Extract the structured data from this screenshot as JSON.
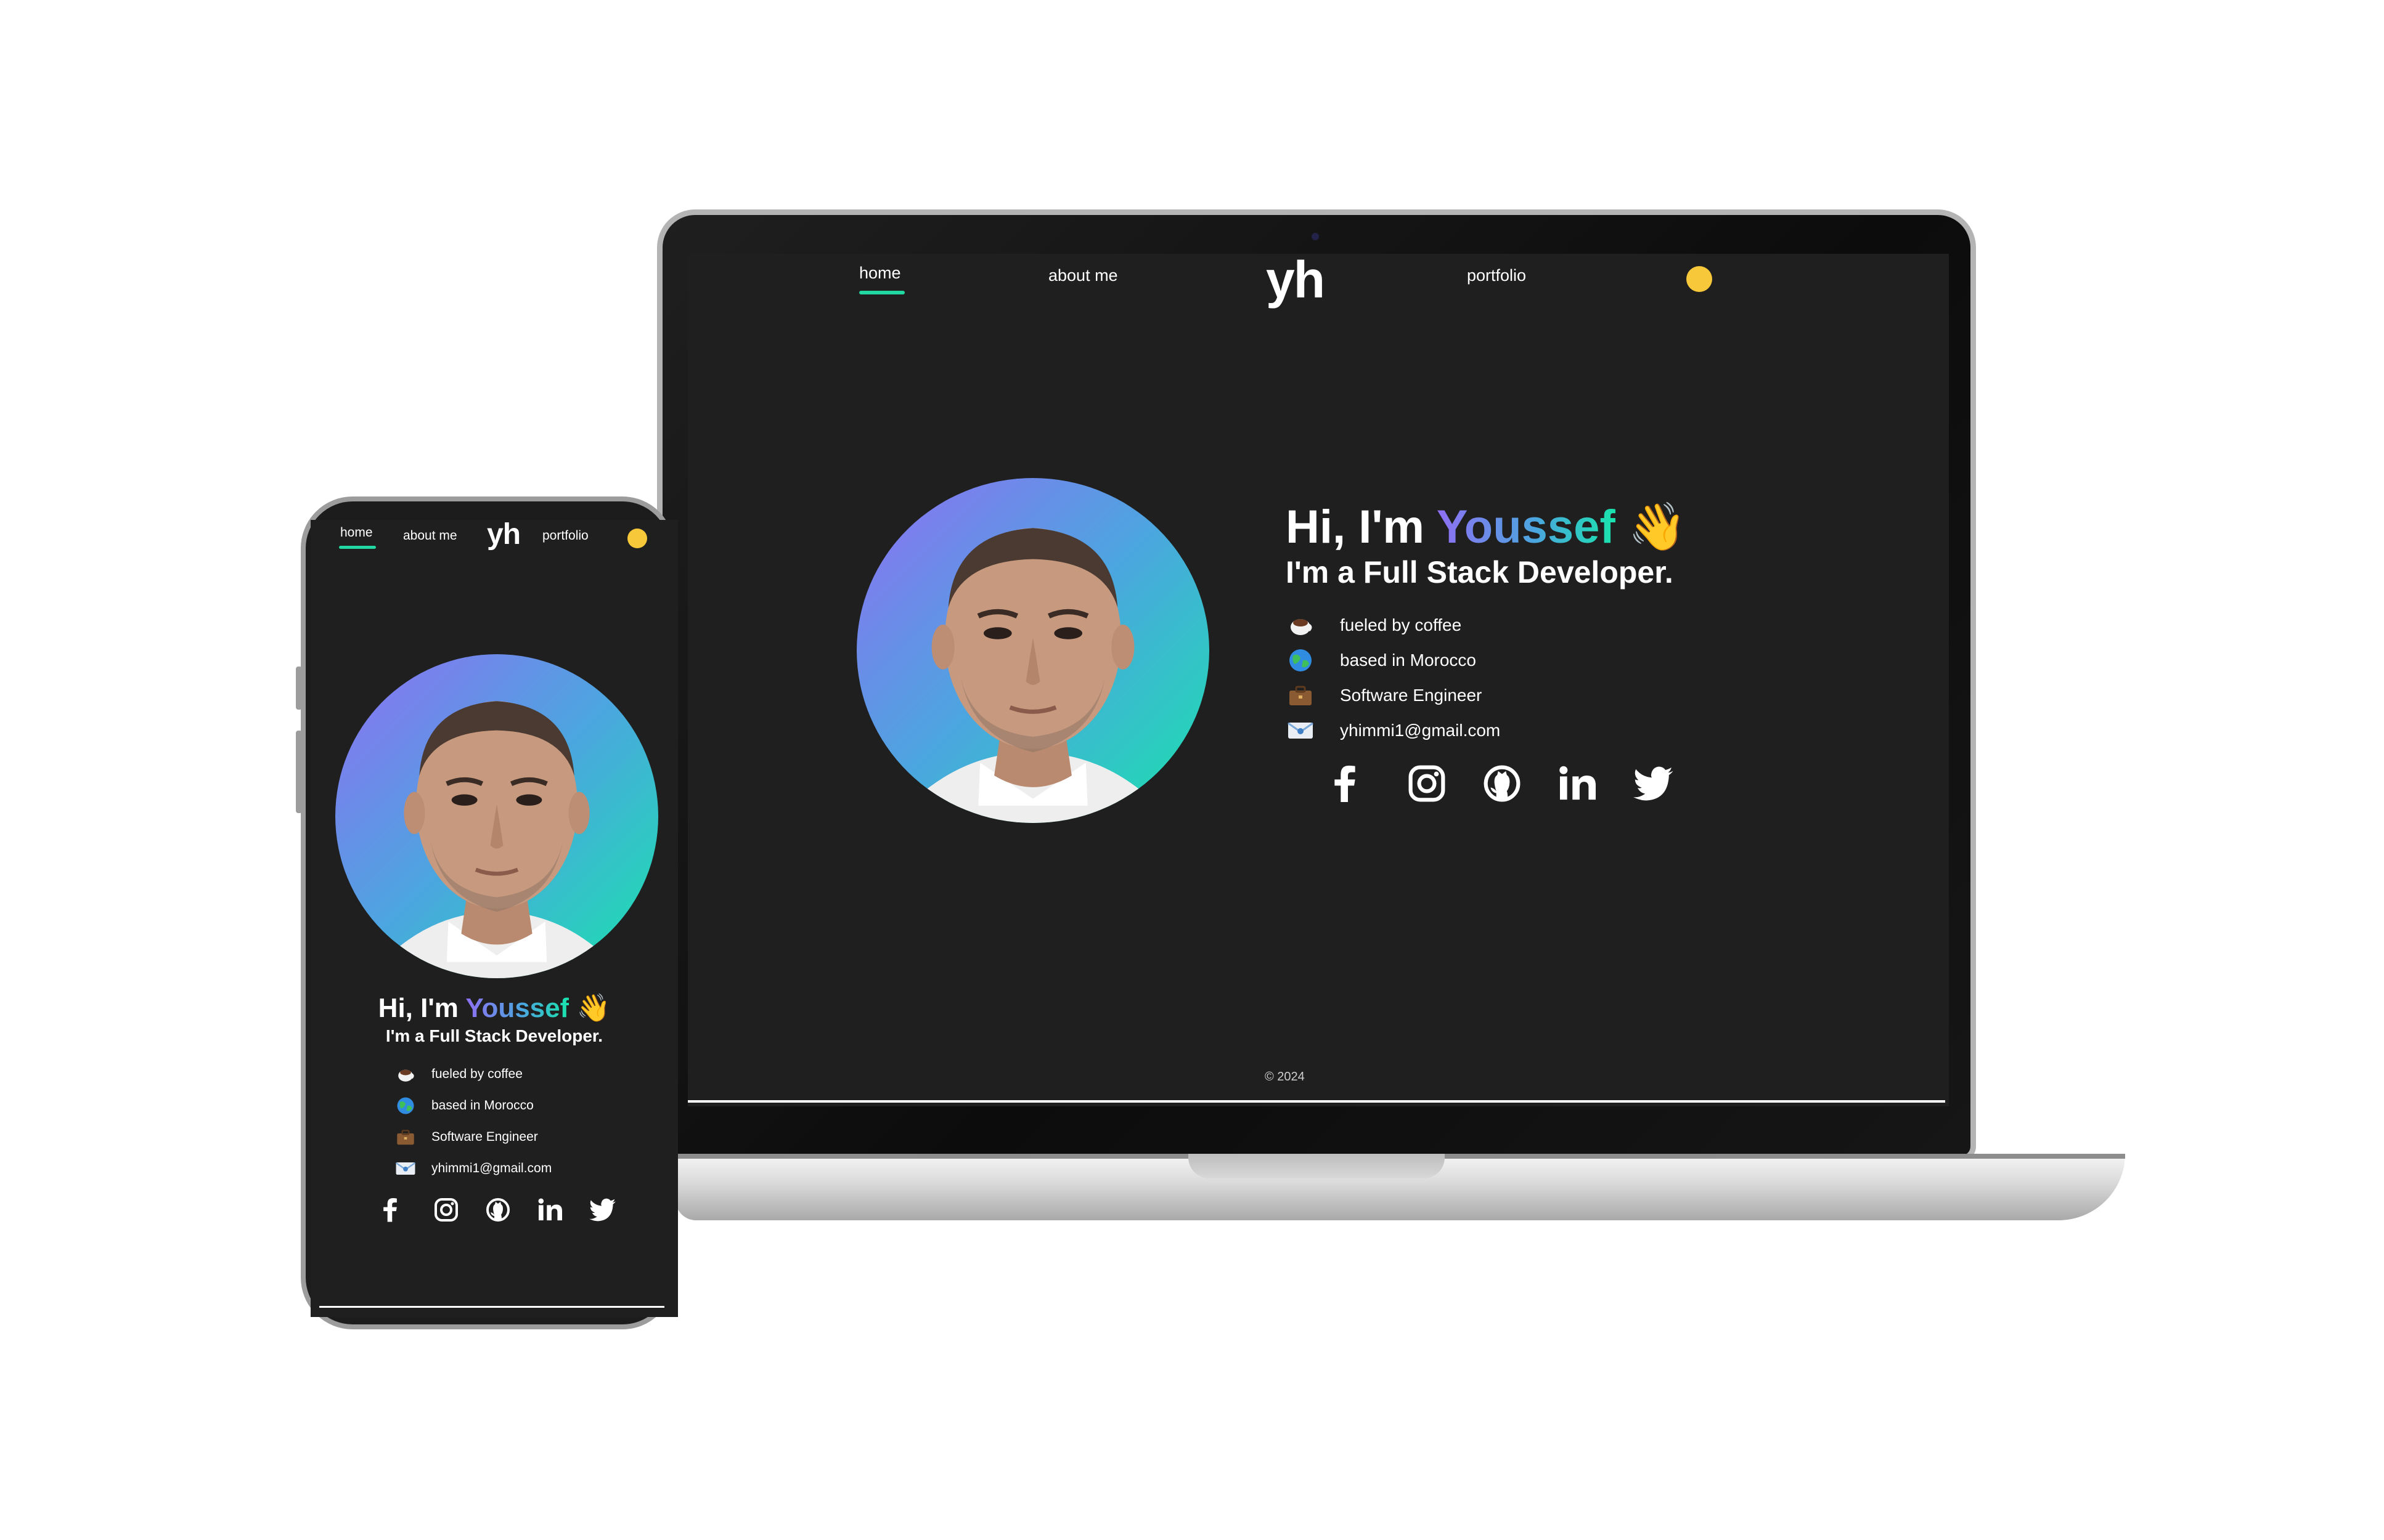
{
  "nav": {
    "home": "home",
    "about": "about me",
    "logo": "yh",
    "portfolio": "portfolio"
  },
  "hero": {
    "greeting_prefix": "Hi, I'm ",
    "name": "Youssef",
    "wave_emoji": "👋",
    "role": "I'm a Full Stack Developer."
  },
  "info": [
    {
      "icon": "coffee-icon",
      "text": "fueled by coffee"
    },
    {
      "icon": "globe-icon",
      "text": "based in Morocco"
    },
    {
      "icon": "briefcase-icon",
      "text": "Software Engineer"
    },
    {
      "icon": "email-icon",
      "text": "yhimmi1@gmail.com"
    }
  ],
  "socials": [
    "facebook-icon",
    "instagram-icon",
    "github-icon",
    "linkedin-icon",
    "twitter-icon"
  ],
  "footer": {
    "copyright": "© 2024"
  },
  "colors": {
    "background": "#1f1f1f",
    "accent": "#21d7a2",
    "toggle": "#f7c83a",
    "gradient_start": "#8f6ff3",
    "gradient_end": "#19e3ad"
  }
}
